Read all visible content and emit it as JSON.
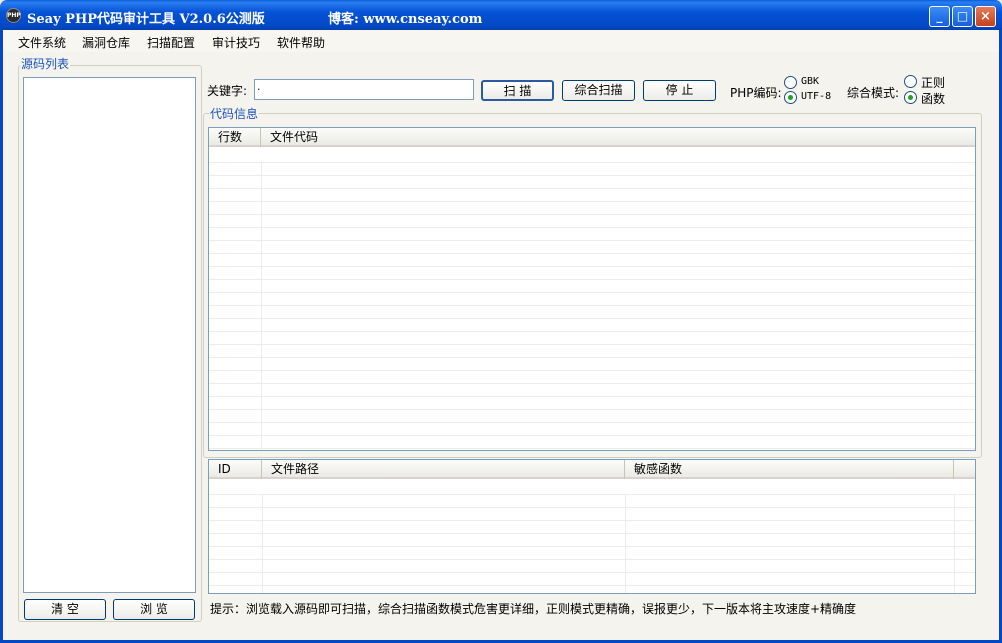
{
  "window": {
    "app_icon": "php-logo-icon",
    "title": "Seay PHP代码审计工具 V2.0.6公测版",
    "blog": "博客: www.cnseay.com",
    "controls": {
      "minimize": "_",
      "maximize": "□",
      "close": "×"
    }
  },
  "menu": [
    "文件系统",
    "漏洞仓库",
    "扫描配置",
    "审计技巧",
    "软件帮助"
  ],
  "source_panel": {
    "label": "源码列表",
    "clear_button": "清 空",
    "browse_button": "浏 览"
  },
  "search": {
    "keyword_label": "关键字:",
    "keyword_value": "·",
    "scan_button": "扫 描",
    "combined_scan_button": "综合扫描",
    "stop_button": "停 止",
    "encoding_label": "PHP编码:",
    "encoding_options": [
      {
        "label": "GBK",
        "checked": false
      },
      {
        "label": "UTF-8",
        "checked": true
      }
    ],
    "mode_label": "综合模式:",
    "mode_options": [
      {
        "label": "正则",
        "checked": false
      },
      {
        "label": "函数",
        "checked": true
      }
    ]
  },
  "code_info": {
    "label": "代码信息",
    "columns": [
      "行数",
      "文件代码"
    ]
  },
  "results": {
    "columns": [
      "ID",
      "文件路径",
      "敏感函数"
    ]
  },
  "hint": "提示：浏览载入源码即可扫描，综合扫描函数模式危害更详细，正则模式更精确，误报更少，下一版本将主攻速度+精确度"
}
